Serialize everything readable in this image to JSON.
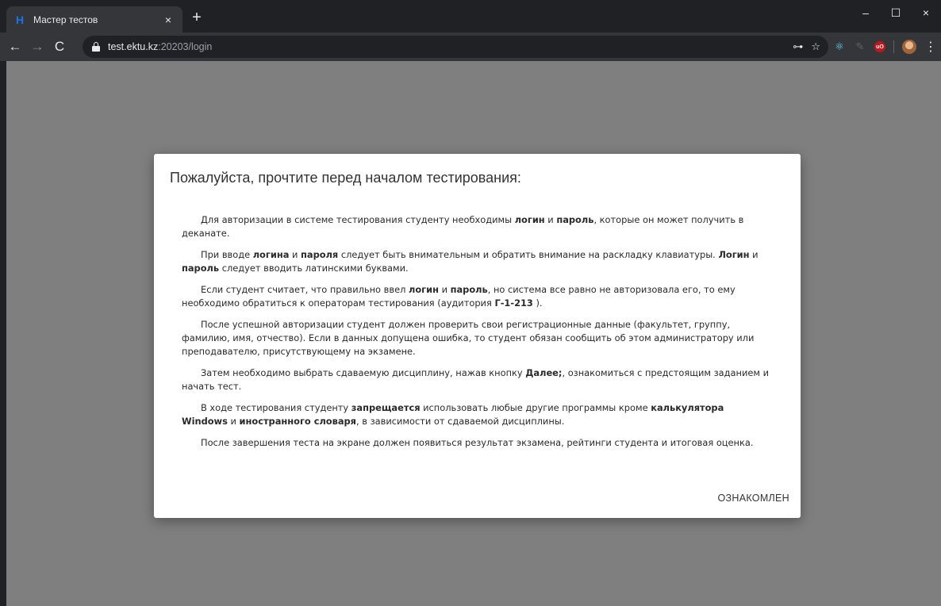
{
  "browser": {
    "tab": {
      "favicon": "H",
      "title": "Мастер тестов",
      "close": "×"
    },
    "new_tab": "+",
    "window_controls": {
      "minimize": "–",
      "maximize": "☐",
      "close": "×"
    },
    "nav": {
      "back": "←",
      "forward": "→",
      "reload": "C"
    },
    "address": {
      "host": "test.ektu.kz",
      "rest": ":20203/login"
    },
    "omnibox_icons": {
      "key": "⊶",
      "star": "☆"
    },
    "menu": "⋮"
  },
  "dialog": {
    "title": "Пожалуйста, прочтите перед началом тестирования:",
    "paragraphs": [
      [
        {
          "t": "Для авторизации в системе тестирования студенту необходимы "
        },
        {
          "t": "логин",
          "b": true
        },
        {
          "t": " и "
        },
        {
          "t": "пароль",
          "b": true
        },
        {
          "t": ", которые он может получить в деканате."
        }
      ],
      [
        {
          "t": "При вводе "
        },
        {
          "t": "логина",
          "b": true
        },
        {
          "t": " и "
        },
        {
          "t": "пароля",
          "b": true
        },
        {
          "t": " следует быть внимательным и обратить внимание на раскладку клавиатуры. "
        },
        {
          "t": "Логин",
          "b": true
        },
        {
          "t": " и "
        },
        {
          "t": "пароль",
          "b": true
        },
        {
          "t": " следует вводить латинскими буквами."
        }
      ],
      [
        {
          "t": "Если студент считает, что правильно ввел "
        },
        {
          "t": "логин",
          "b": true
        },
        {
          "t": " и "
        },
        {
          "t": "пароль",
          "b": true
        },
        {
          "t": ", но система все равно не авторизовала его, то ему необходимо обратиться к операторам тестирования (аудитория "
        },
        {
          "t": "Г-1-213",
          "b": true
        },
        {
          "t": " )."
        }
      ],
      [
        {
          "t": "После успешной авторизации студент должен проверить свои регистрационные данные (факультет, группу, фамилию, имя, отчество). Если в данных допущена ошибка, то студент обязан сообщить об этом администратору или преподавателю, присутствующему на экзамене."
        }
      ],
      [
        {
          "t": "Затем необходимо выбрать сдаваемую дисциплину, нажав кнопку "
        },
        {
          "t": "Далее;",
          "b": true
        },
        {
          "t": ", ознакомиться с предстоящим заданием и начать тест."
        }
      ],
      [
        {
          "t": "В ходе тестирования студенту "
        },
        {
          "t": "запрещается",
          "b": true
        },
        {
          "t": " использовать любые другие программы кроме "
        },
        {
          "t": "калькулятора Windows",
          "b": true
        },
        {
          "t": " и "
        },
        {
          "t": "иностранного словаря",
          "b": true
        },
        {
          "t": ", в зависимости от сдаваемой дисциплины."
        }
      ],
      [
        {
          "t": "После завершения теста на экране должен появиться результат экзамена, рейтинги студента и итоговая оценка."
        }
      ]
    ],
    "ok_label": "ОЗНАКОМЛЕН"
  }
}
